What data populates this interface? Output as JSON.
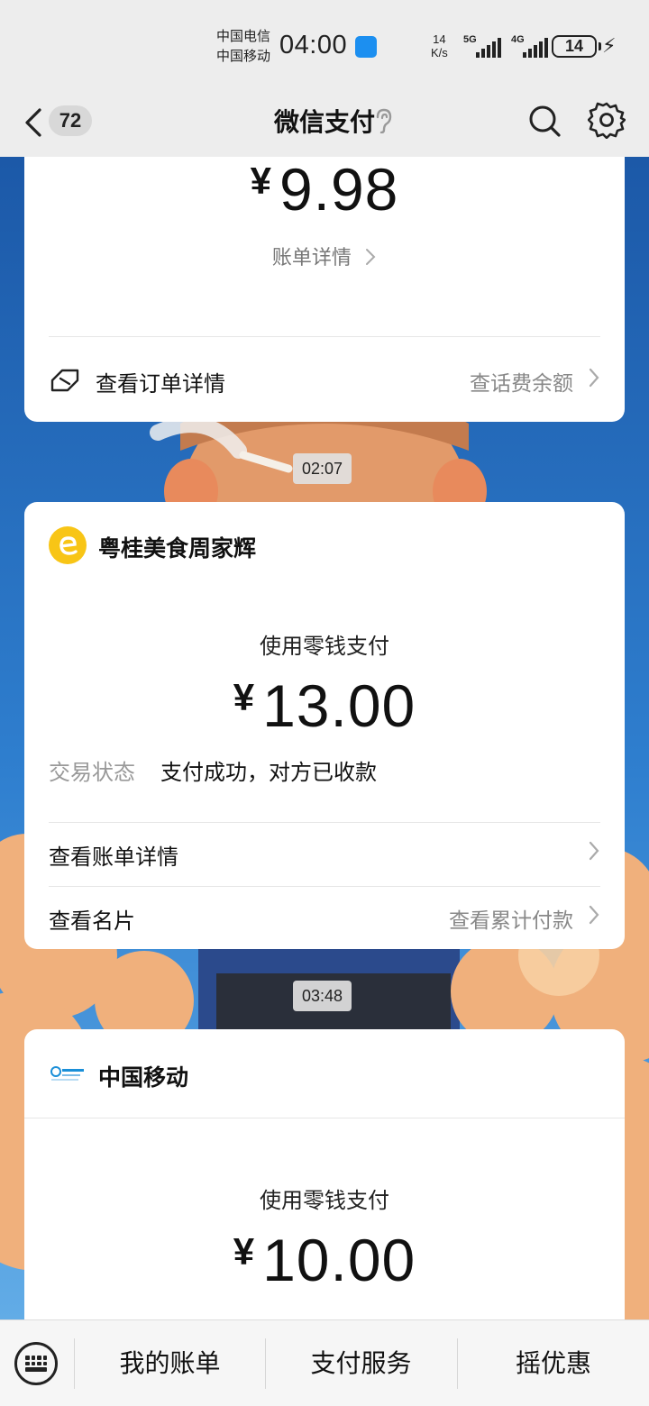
{
  "status_bar": {
    "carrier1": "中国电信",
    "carrier2": "中国移动",
    "time": "04:00",
    "speed_value": "14",
    "speed_unit": "K/s",
    "net1": "5G",
    "net2": "4G",
    "battery": "14"
  },
  "nav": {
    "badge": "72",
    "title": "微信支付"
  },
  "card1": {
    "currency": "¥",
    "amount": "9.98",
    "detail_link": "账单详情",
    "row_label": "查看订单详情",
    "row_right": "查话费余额"
  },
  "timestamps": [
    "02:07",
    "03:48"
  ],
  "card2": {
    "merchant": "粤桂美食周家辉",
    "pay_method": "使用零钱支付",
    "currency": "¥",
    "amount": "13.00",
    "status_label": "交易状态",
    "status_value": "支付成功，对方已收款",
    "row1_label": "查看账单详情",
    "row2_label": "查看名片",
    "row2_right": "查看累计付款"
  },
  "card3": {
    "merchant": "中国移动",
    "pay_method": "使用零钱支付",
    "currency": "¥",
    "amount": "10.00"
  },
  "bottom_bar": {
    "tabs": [
      "我的账单",
      "支付服务",
      "摇优惠"
    ]
  }
}
